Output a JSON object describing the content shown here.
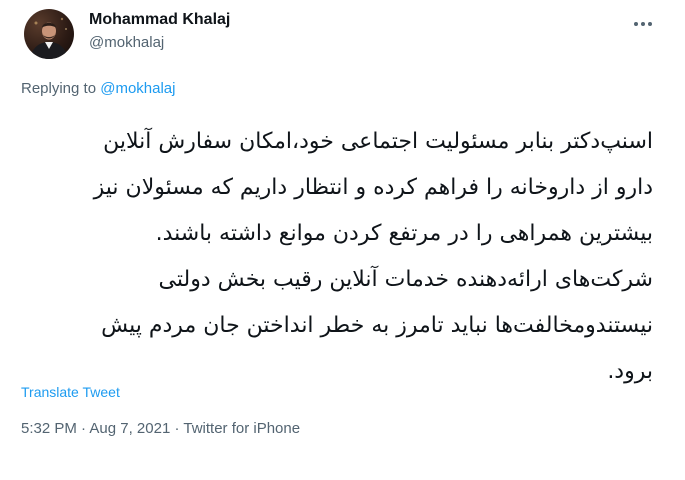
{
  "author": {
    "name": "Mohammad Khalaj",
    "handle": "@mokhalaj"
  },
  "replying": {
    "prefix": "Replying to ",
    "mention": "@mokhalaj"
  },
  "tweet_lines": [
    "اسنپ‌دکتر بنابر مسئولیت اجتماعی خود،امکان سفارش آنلاین",
    "دارو از داروخانه را فراهم کرده و انتظار داریم که مسئولان نیز",
    "بیشترین همراهی را در مرتفع کردن موانع داشته باشند.",
    "شرکت‌های ارائه‌دهنده خدمات آنلاین رقیب بخش دولتی",
    "نیستندومخالفت‌ها نباید تامرز به خطر انداختن جان مردم پیش",
    "برود."
  ],
  "translate_label": "Translate Tweet",
  "meta": {
    "time": "5:32 PM",
    "sep1": " · ",
    "date": "Aug 7, 2021",
    "sep2": " · ",
    "source": "Twitter for iPhone"
  },
  "icons": {
    "more": "more-horizontal-icon"
  },
  "colors": {
    "accent": "#1d9bf0",
    "secondary_text": "#536471",
    "primary_text": "#0f1419"
  }
}
